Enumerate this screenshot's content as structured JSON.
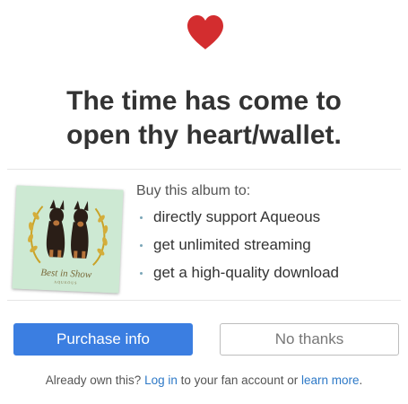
{
  "icons": {
    "heart": "heart-icon"
  },
  "colors": {
    "heart": "#d32d2f",
    "primary_button": "#3b7ee1",
    "link": "#2d79c7",
    "bullet": "#7aa6b8"
  },
  "headline": {
    "line1": "The time has come to",
    "line2": "open thy heart/wallet."
  },
  "album": {
    "title": "Best in Show",
    "subtitle": "AQUEOUS"
  },
  "buy": {
    "heading": "Buy this album to:",
    "benefits": [
      "directly support Aqueous",
      "get unlimited streaming",
      "get a high-quality download"
    ]
  },
  "buttons": {
    "purchase": "Purchase info",
    "no_thanks": "No thanks"
  },
  "footer": {
    "prefix": "Already own this?",
    "login_link": "Log in",
    "middle": "to your fan account or",
    "learn_link": "learn more",
    "suffix": "."
  }
}
